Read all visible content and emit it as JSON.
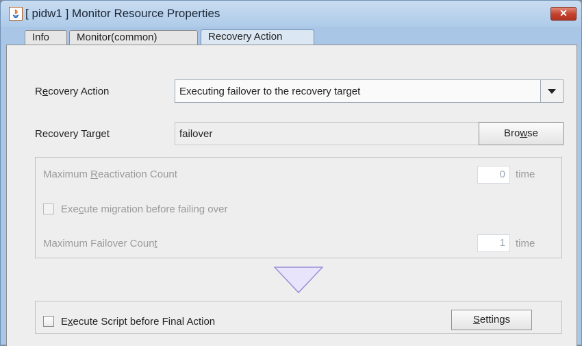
{
  "window": {
    "title": "[ pidw1 ] Monitor Resource Properties",
    "close_glyph": "✕",
    "icon": "java-icon"
  },
  "tabs": [
    {
      "label": "Info"
    },
    {
      "label": "Monitor(common)"
    },
    {
      "label": "Recovery Action",
      "selected": true
    }
  ],
  "recovery_action": {
    "label_pre": "R",
    "label_u": "e",
    "label_post": "covery Action",
    "selected_value": "Executing failover to the recovery target"
  },
  "recovery_target": {
    "label": "Recovery Target",
    "value": "failover",
    "browse_pre": "Bro",
    "browse_u": "w",
    "browse_post": "se"
  },
  "reactivation": {
    "label_pre": "Maximum ",
    "label_u": "R",
    "label_post": "eactivation Count",
    "value": "0",
    "unit": "time"
  },
  "migration": {
    "label_pre": "Exe",
    "label_u": "c",
    "label_post": "ute migration before failing over",
    "checked": false
  },
  "failover_count": {
    "label_pre": "Maximum Failover Coun",
    "label_u": "t",
    "value": "1",
    "unit": "time"
  },
  "final_script": {
    "label_pre": "E",
    "label_u": "x",
    "label_post": "ecute Script before Final Action",
    "checked": false,
    "settings_u": "S",
    "settings_post": "ettings"
  },
  "colors": {
    "titlebar": "#aecbe9",
    "close": "#c3402c",
    "arrow": "#9a8fd8"
  }
}
